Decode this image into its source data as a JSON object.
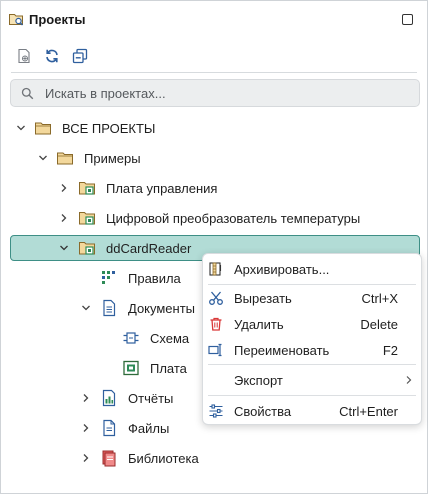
{
  "panel": {
    "title": "Проекты"
  },
  "toolbar": {
    "buttons": [
      "new-project-icon",
      "refresh-icon",
      "collapse-all-icon"
    ]
  },
  "search": {
    "placeholder": "Искать в проектах...",
    "value": ""
  },
  "tree": {
    "all_projects": "ВСЕ ПРОЕКТЫ",
    "examples": "Примеры",
    "control_board": "Плата управления",
    "temp_converter": "Цифровой преобразователь температуры",
    "dd_card_reader": "ddCardReader",
    "rules": "Правила",
    "documents": "Документы",
    "schema": "Схема",
    "board": "Плата",
    "reports": "Отчёты",
    "files": "Файлы",
    "library": "Библиотека"
  },
  "context_menu": {
    "archive": "Архивировать...",
    "cut": "Вырезать",
    "cut_shortcut": "Ctrl+X",
    "delete": "Удалить",
    "delete_shortcut": "Delete",
    "rename": "Переименовать",
    "rename_shortcut": "F2",
    "export": "Экспорт",
    "properties": "Свойства",
    "properties_shortcut": "Ctrl+Enter"
  },
  "colors": {
    "accent": "#3e8f86",
    "selection": "#b2dcd6",
    "folder": "#f3d89c",
    "folder_stroke": "#8a6a2a",
    "project_green": "#2e8b57",
    "delete_red": "#d93838",
    "icon_blue": "#2f5f9e"
  }
}
